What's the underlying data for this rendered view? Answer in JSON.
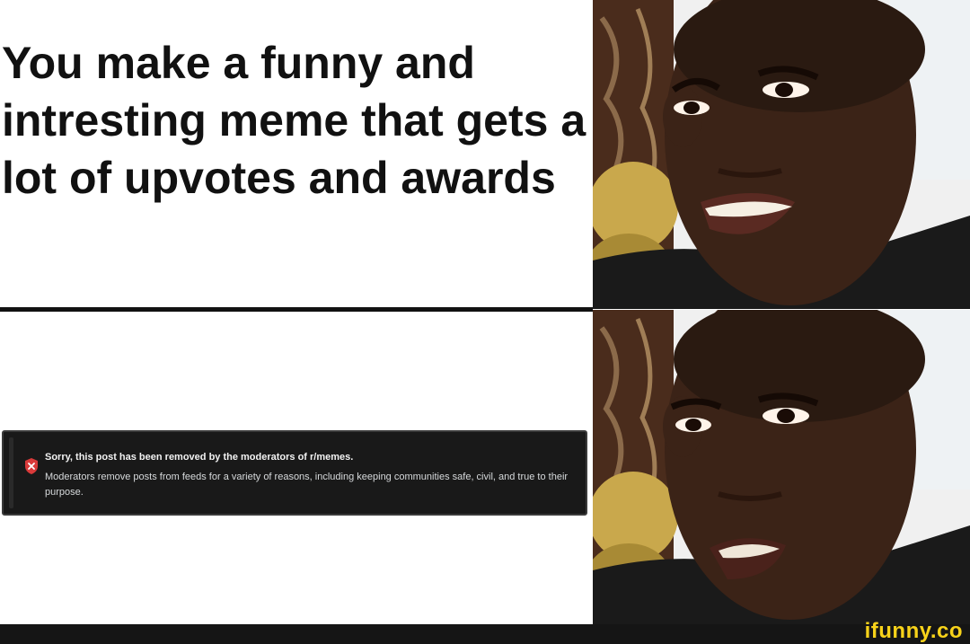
{
  "meme": {
    "top_caption": "You make a funny and intresting meme that gets a lot of upvotes and awards",
    "notice": {
      "icon": "shield-x-icon",
      "title": "Sorry, this post has been removed by the moderators of r/memes.",
      "body": "Moderators remove posts from feeds for a variety of reasons, including keeping communities safe, civil, and true to their purpose."
    },
    "panels": [
      {
        "expression": "happy-smiling-man"
      },
      {
        "expression": "disappointed-man"
      }
    ],
    "watermark": "ifunny.co",
    "colors": {
      "notice_bg": "#191919",
      "icon_red": "#d93a3a",
      "watermark": "#f7d21a"
    }
  }
}
